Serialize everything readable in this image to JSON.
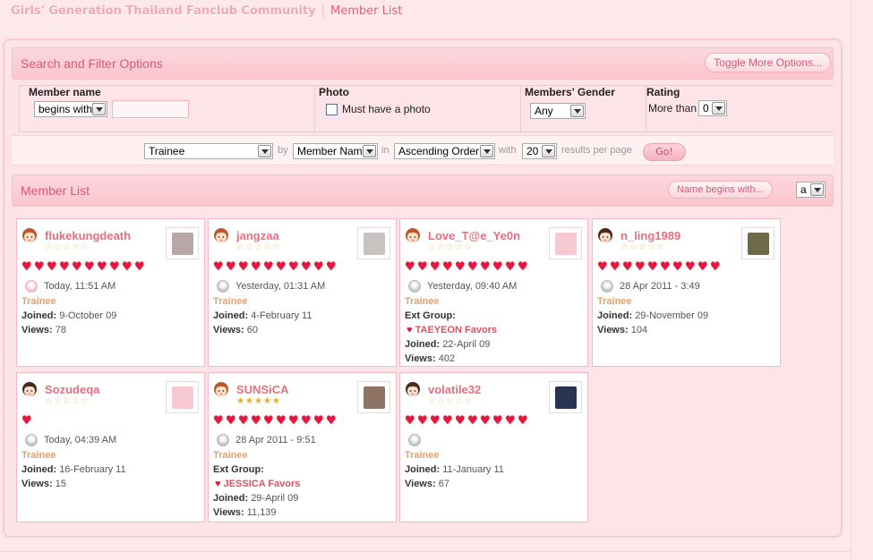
{
  "breadcrumb": {
    "site": "Girls' Generation Thailand Fanclub Community",
    "separator": "|",
    "current": "Member List"
  },
  "search": {
    "title": "Search and Filter Options",
    "toggle_label": "Toggle More Options...",
    "member_name_label": "Member name",
    "name_match": "begins with",
    "name_value": "",
    "photo_label": "Photo",
    "photo_option": "Must have a photo",
    "gender_label": "Members' Gender",
    "gender_value": "Any",
    "rating_label": "Rating",
    "rating_prefix": "More than",
    "rating_value": "0"
  },
  "sortbar": {
    "group": "Trainee",
    "by_label": "by",
    "sort_field": "Member Name",
    "in_label": "in",
    "order": "Ascending Order",
    "with_label": "with",
    "per_page": "20",
    "per_page_suffix": "results per page",
    "go_label": "Go!"
  },
  "list": {
    "title": "Member List",
    "name_begins_label": "Name begins with...",
    "letter": "a"
  },
  "icons": {
    "heart": "heart-icon",
    "star": "star-icon",
    "status": "status-icon",
    "face": "avatar-face-icon"
  },
  "colors": {
    "accent": "#e0557a",
    "username": "#e86d83",
    "rank": "#e3a16e",
    "heart": "#e8163d"
  },
  "members": [
    {
      "name": "flukekungdeath",
      "stars_gold": 0,
      "hearts": 10,
      "last_seen": "Today, 11:51 AM",
      "online": true,
      "rank": "Trainee",
      "joined_label": "Joined:",
      "joined": "9-October 09",
      "views_label": "Views:",
      "views": "78",
      "face": "boy",
      "photo": "#b9a8a8"
    },
    {
      "name": "jangzaa",
      "stars_gold": 0,
      "hearts": 10,
      "last_seen": "Yesterday, 01:31 AM",
      "online": false,
      "rank": "Trainee",
      "joined_label": "Joined:",
      "joined": "4-February 11",
      "views_label": "Views:",
      "views": "60",
      "face": "boy",
      "photo": "#c9c2c0"
    },
    {
      "name": "Love_T@e_Ye0n",
      "stars_gold": 0,
      "hearts": 10,
      "last_seen": "Yesterday, 09:40 AM",
      "online": false,
      "rank": "Trainee",
      "ext_group_label": "Ext Group:",
      "favor": "TAEYEON Favors",
      "joined_label": "Joined:",
      "joined": "22-April 09",
      "views_label": "Views:",
      "views": "402",
      "face": "boy",
      "photo": "#f6c8d1"
    },
    {
      "name": "n_ling1989",
      "stars_gold": 0,
      "hearts": 10,
      "last_seen": "28 Apr 2011 - 3:49",
      "online": false,
      "rank": "Trainee",
      "joined_label": "Joined:",
      "joined": "29-November 09",
      "views_label": "Views:",
      "views": "104",
      "face": "girl",
      "photo": "#6f6a4a"
    },
    {
      "name": "Sozudeqa",
      "stars_gold": 0,
      "hearts": 1,
      "last_seen": "Today, 04:39 AM",
      "online": false,
      "rank": "Trainee",
      "joined_label": "Joined:",
      "joined": "16-February 11",
      "views_label": "Views:",
      "views": "15",
      "face": "girl",
      "photo": "#f6c8d1"
    },
    {
      "name": "SUNSiCA",
      "stars_gold": 5,
      "hearts": 10,
      "last_seen": "28 Apr 2011 - 9:51",
      "online": false,
      "rank": "Trainee",
      "ext_group_label": "Ext Group:",
      "favor": "JESSICA Favors",
      "joined_label": "Joined:",
      "joined": "29-April 09",
      "views_label": "Views:",
      "views": "11,139",
      "face": "boy",
      "photo": "#8d7464"
    },
    {
      "name": "volatile32",
      "stars_gold": 0,
      "hearts": 10,
      "last_seen": "",
      "online": false,
      "rank": "Trainee",
      "joined_label": "Joined:",
      "joined": "11-January 11",
      "views_label": "Views:",
      "views": "67",
      "face": "girl",
      "photo": "#2a3350"
    }
  ]
}
